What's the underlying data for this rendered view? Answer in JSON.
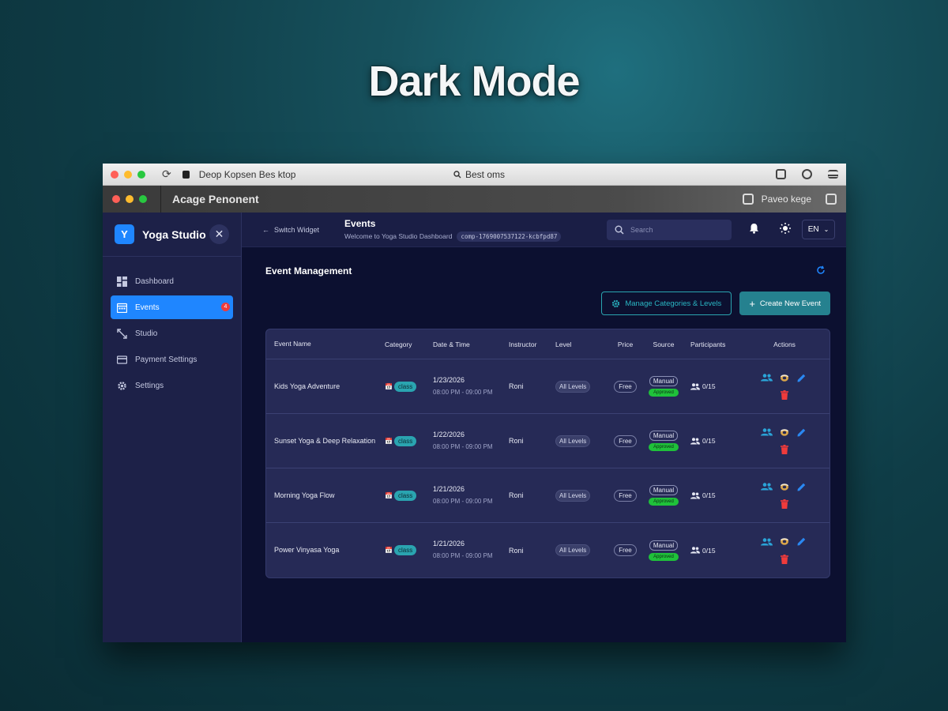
{
  "hero": {
    "title": "Dark Mode"
  },
  "browser": {
    "url": "Deop Kopsen Bes ktop",
    "center_text": "Best oms"
  },
  "app_window": {
    "title": "Acage Penonent",
    "right_text": "Paveo kege"
  },
  "sidebar": {
    "brand_initial": "Y",
    "brand_name": "Yoga Studio",
    "close_label": "✕",
    "items": [
      {
        "label": "Dashboard",
        "icon": "dashboard-icon",
        "active": false
      },
      {
        "label": "Events",
        "icon": "calendar-icon",
        "active": true,
        "badge": "4"
      },
      {
        "label": "Studio",
        "icon": "resize-arrows-icon",
        "active": false
      },
      {
        "label": "Payment Settings",
        "icon": "credit-card-icon",
        "active": false
      },
      {
        "label": "Settings",
        "icon": "gear-icon",
        "active": false
      }
    ]
  },
  "topbar": {
    "switch_label": "Switch Widget",
    "title": "Events",
    "subtitle": "Welcome to Yoga Studio Dashboard",
    "comp_id": "comp-1769007537122-kcbfpd87",
    "search_placeholder": "Search",
    "language": "EN"
  },
  "section": {
    "title": "Event Management",
    "manage_button": "Manage Categories & Levels",
    "create_button": "Create New Event"
  },
  "table": {
    "columns": [
      "Event Name",
      "Category",
      "Date & Time",
      "Instructor",
      "Level",
      "Price",
      "Source",
      "Participants",
      "Actions"
    ],
    "rows": [
      {
        "name": "Kids Yoga Adventure",
        "category": "class",
        "date": "1/23/2026",
        "time": "08:00 PM - 09:00 PM",
        "instructor": "Roni",
        "level": "All Levels",
        "price": "Free",
        "source": "Manual",
        "status": "Approved",
        "participants": "0/15"
      },
      {
        "name": "Sunset Yoga & Deep Relaxation",
        "category": "class",
        "date": "1/22/2026",
        "time": "08:00 PM - 09:00 PM",
        "instructor": "Roni",
        "level": "All Levels",
        "price": "Free",
        "source": "Manual",
        "status": "Approved",
        "participants": "0/15"
      },
      {
        "name": "Morning Yoga Flow",
        "category": "class",
        "date": "1/21/2026",
        "time": "08:00 PM - 09:00 PM",
        "instructor": "Roni",
        "level": "All Levels",
        "price": "Free",
        "source": "Manual",
        "status": "Approved",
        "participants": "0/15"
      },
      {
        "name": "Power Vinyasa Yoga",
        "category": "class",
        "date": "1/21/2026",
        "time": "08:00 PM - 09:00 PM",
        "instructor": "Roni",
        "level": "All Levels",
        "price": "Free",
        "source": "Manual",
        "status": "Approved",
        "participants": "0/15"
      }
    ]
  },
  "colors": {
    "accent": "#1f86ff",
    "teal": "#2aa4b0",
    "approved": "#1fc13a",
    "delete": "#ef3b3b",
    "sidebar_bg": "#1d2148",
    "main_bg": "#0c1030"
  }
}
